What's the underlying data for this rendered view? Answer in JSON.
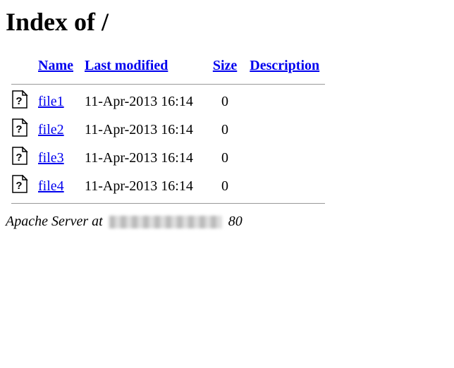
{
  "page": {
    "title": "Index of /"
  },
  "headers": {
    "name": "Name",
    "modified": "Last modified",
    "size": "Size",
    "description": "Description"
  },
  "files": [
    {
      "name": "file1",
      "modified": "11-Apr-2013 16:14",
      "size": "0",
      "description": ""
    },
    {
      "name": "file2",
      "modified": "11-Apr-2013 16:14",
      "size": "0",
      "description": ""
    },
    {
      "name": "file3",
      "modified": "11-Apr-2013 16:14",
      "size": "0",
      "description": ""
    },
    {
      "name": "file4",
      "modified": "11-Apr-2013 16:14",
      "size": "0",
      "description": ""
    }
  ],
  "footer": {
    "prefix": "Apache Server at",
    "suffix": "80"
  }
}
